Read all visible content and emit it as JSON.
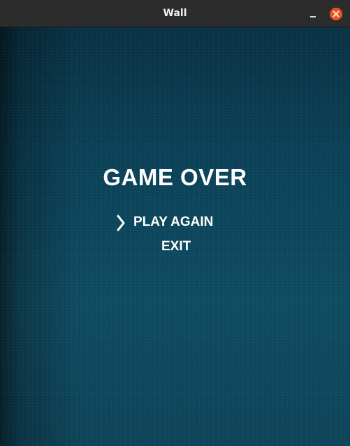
{
  "window": {
    "title": "Wall",
    "controls": {
      "minimize_icon": "minimize-icon",
      "close_icon": "close-icon",
      "close_color": "#e95420"
    }
  },
  "game": {
    "title": "GAME OVER",
    "menu": {
      "items": [
        {
          "label": "PLAY AGAIN",
          "selected": true
        },
        {
          "label": "EXIT",
          "selected": false
        }
      ],
      "selector_icon": "chevron-right-icon"
    },
    "background_color": "#0a4157"
  }
}
